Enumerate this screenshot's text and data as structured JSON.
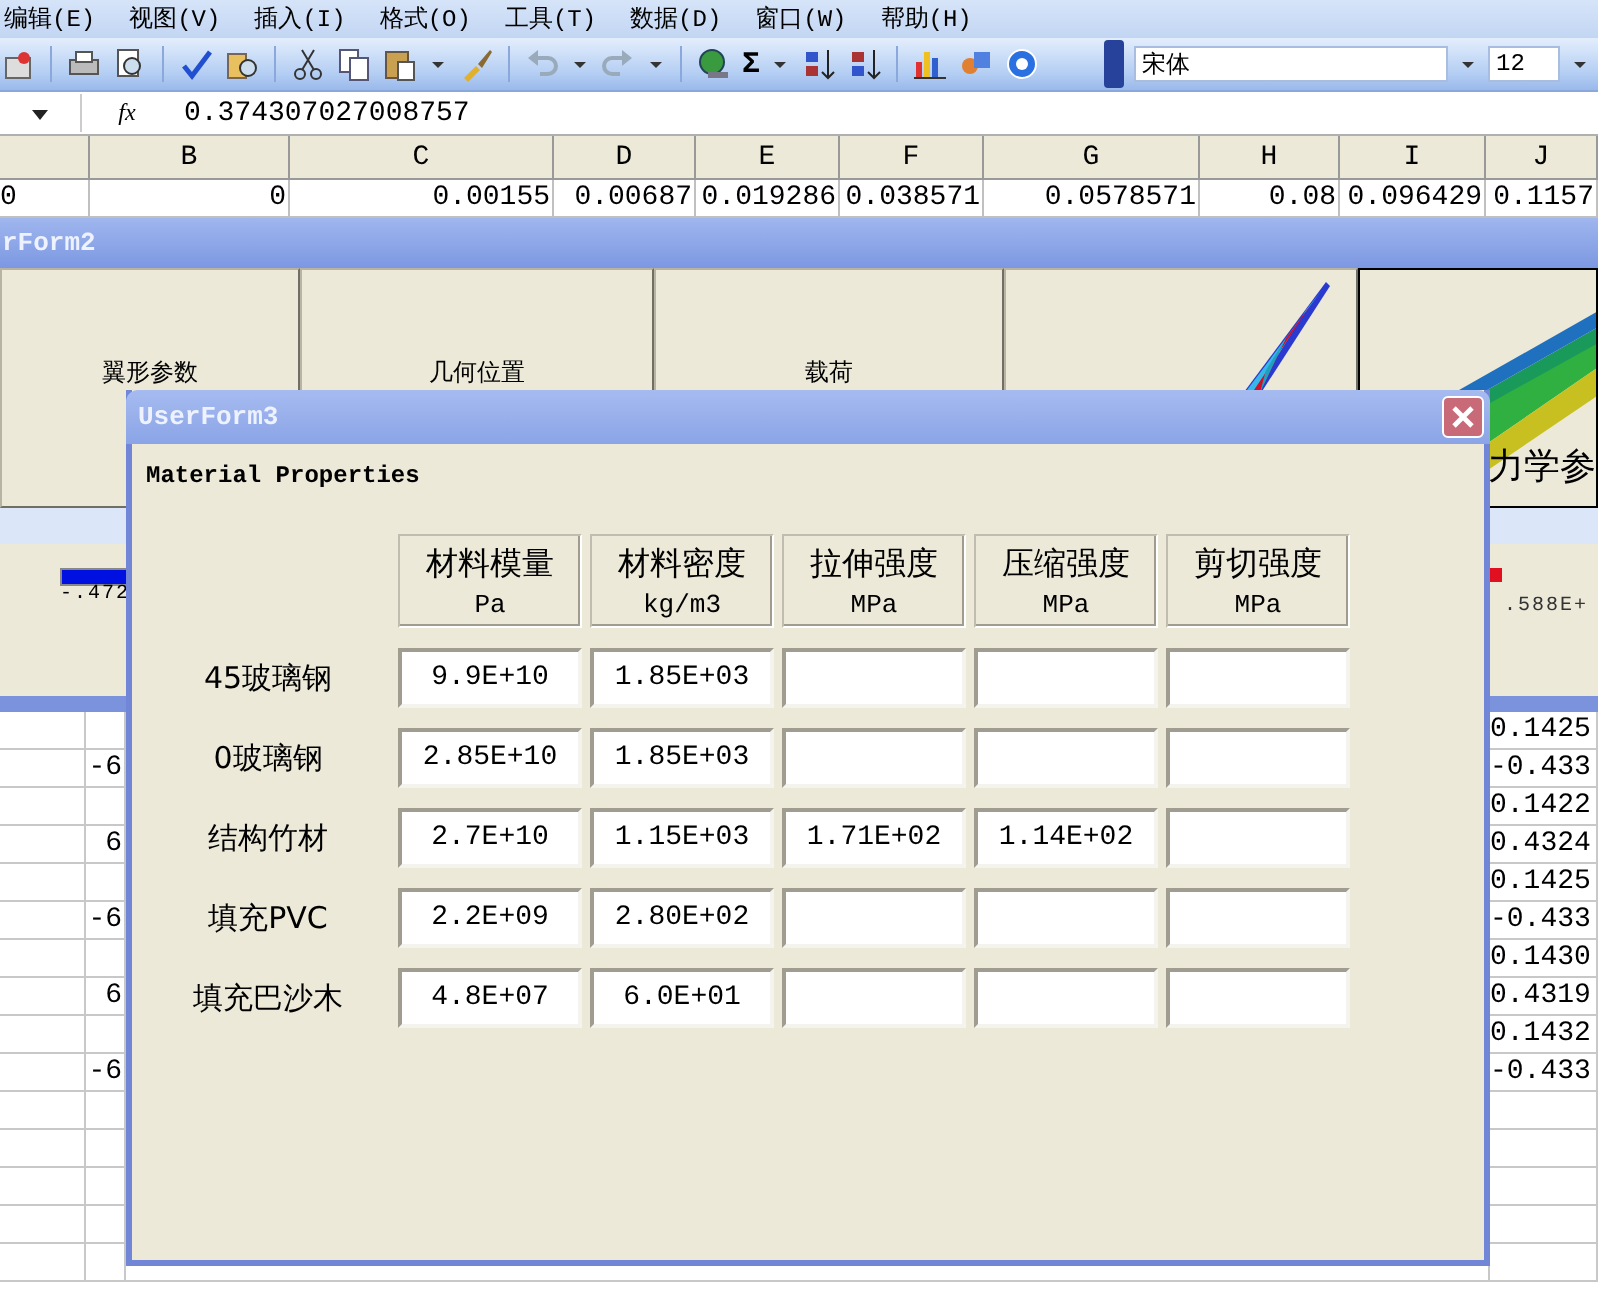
{
  "menu_bar": {
    "items": [
      "编辑(E)",
      "视图(V)",
      "插入(I)",
      "格式(O)",
      "工具(T)",
      "数据(D)",
      "窗口(W)",
      "帮助(H)"
    ]
  },
  "toolbar": {
    "sum_symbol": "Σ",
    "font_name": "宋体",
    "font_size": "12"
  },
  "formula_bar": {
    "function_label": "fx",
    "value": "0.374307027008757"
  },
  "sheet": {
    "columns": [
      "B",
      "C",
      "D",
      "E",
      "F",
      "G",
      "H",
      "I",
      "J"
    ],
    "top_row": [
      "0",
      "0",
      "0.00155",
      "0.00687",
      "0.019286",
      "0.038571",
      "0.0578571",
      "0.08",
      "0.096429",
      "0.1157"
    ],
    "lower_rows": [
      {
        "column_j": "0.1425"
      },
      {
        "column_b": "-6",
        "column_j": "-0.433"
      },
      {
        "column_j": "0.1422"
      },
      {
        "column_b": "6",
        "column_j": "0.4324"
      },
      {
        "column_j": "0.1425"
      },
      {
        "column_b": "-6",
        "column_j": "-0.433"
      },
      {
        "column_j": "0.1430"
      },
      {
        "column_b": "6",
        "column_j": "0.4319"
      },
      {
        "column_j": "0.1432"
      },
      {
        "column_b": "-6",
        "column_j": "-0.433"
      }
    ]
  },
  "userform2": {
    "title": "rForm2",
    "buttons": [
      {
        "kind": "text",
        "label": "翼形参数",
        "selected": false
      },
      {
        "kind": "text",
        "label": "几何位置",
        "selected": false
      },
      {
        "kind": "text",
        "label": "载荷",
        "selected": false
      },
      {
        "kind": "picture",
        "selected": false
      },
      {
        "kind": "picture",
        "label": "力学参",
        "selected": true
      }
    ],
    "legend": {
      "min_label": "-.472",
      "max_label": ".588E+"
    }
  },
  "userform3": {
    "title": "UserForm3",
    "heading": "Material Properties",
    "columns": [
      {
        "name": "材料模量",
        "unit": "Pa"
      },
      {
        "name": "材料密度",
        "unit": "kg/m3"
      },
      {
        "name": "拉伸强度",
        "unit": "MPa"
      },
      {
        "name": "压缩强度",
        "unit": "MPa"
      },
      {
        "name": "剪切强度",
        "unit": "MPa"
      }
    ],
    "rows": [
      {
        "label": "45玻璃钢",
        "values": [
          "9.9E+10",
          "1.85E+03"
        ]
      },
      {
        "label": "0玻璃钢",
        "values": [
          "2.85E+10",
          "1.85E+03"
        ]
      },
      {
        "label": "结构竹材",
        "values": [
          "2.7E+10",
          "1.15E+03",
          "1.71E+02",
          "1.14E+02"
        ]
      },
      {
        "label": "填充PVC",
        "values": [
          "2.2E+09",
          "2.80E+02"
        ]
      },
      {
        "label": "填充巴沙木",
        "values": [
          "4.8E+07",
          "6.0E+01"
        ]
      }
    ]
  }
}
